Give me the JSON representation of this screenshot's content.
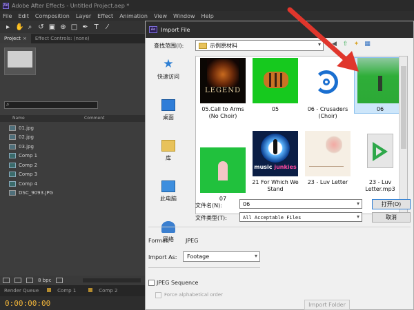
{
  "app": {
    "title": "Adobe After Effects - Untitled Project.aep *",
    "icon_name": "after-effects-icon"
  },
  "menu": [
    "File",
    "Edit",
    "Composition",
    "Layer",
    "Effect",
    "Animation",
    "View",
    "Window",
    "Help"
  ],
  "project_panel": {
    "tabs": [
      {
        "label": "Project",
        "close": "×"
      },
      {
        "label": "Effect Controls: (none)"
      }
    ],
    "columns": {
      "name": "Name",
      "comment": "Comment"
    },
    "items": [
      {
        "label": "01.jpg",
        "icon": "image-icon"
      },
      {
        "label": "02.jpg",
        "icon": "image-icon"
      },
      {
        "label": "03.jpg",
        "icon": "image-icon"
      },
      {
        "label": "Comp 1",
        "icon": "composition-icon"
      },
      {
        "label": "Comp 2",
        "icon": "composition-icon"
      },
      {
        "label": "Comp 3",
        "icon": "composition-icon"
      },
      {
        "label": "Comp 4",
        "icon": "composition-icon"
      },
      {
        "label": "DSC_9093.JPG",
        "icon": "image-icon"
      }
    ],
    "bpc": "8 bpc"
  },
  "bottom": {
    "tabs": [
      "Render Queue",
      "Comp 1",
      "Comp 2"
    ],
    "timecode": "0:00:00:00"
  },
  "import_dialog": {
    "title": "Import File",
    "look_in_label": "查找范围(I):",
    "look_in_value": "示例原材料",
    "places": [
      {
        "label": "快速访问",
        "icon": "quick-access-icon"
      },
      {
        "label": "桌面",
        "icon": "desktop-icon"
      },
      {
        "label": "库",
        "icon": "library-icon"
      },
      {
        "label": "此电脑",
        "icon": "this-pc-icon"
      },
      {
        "label": "网络",
        "icon": "network-icon"
      }
    ],
    "files": [
      {
        "label": "05.Call to Arms (No Choir)",
        "thumb": "legend"
      },
      {
        "label": "05",
        "thumb": "tiger"
      },
      {
        "label": "06 - Crusaders (Choir)",
        "thumb": "crusaders"
      },
      {
        "label": "06",
        "thumb": "green",
        "selected": true
      },
      {
        "label": "07",
        "thumb": "green-person"
      },
      {
        "label": "21 For Which We Stand",
        "thumb": "music-junkies"
      },
      {
        "label": "23 - Luv Letter",
        "thumb": "luv-letter"
      },
      {
        "label": "23 - Luv Letter.mp3",
        "thumb": "mp3"
      }
    ],
    "legend_text": "LEGEND",
    "music_brand_1": "music ",
    "music_brand_2": "junkies",
    "file_name_label": "文件名(N):",
    "file_name_value": "06",
    "file_type_label": "文件类型(T):",
    "file_type_value": "All Acceptable Files",
    "open_label": "打开(O)",
    "cancel_label": "取消",
    "format_label": "Format:",
    "format_value": "JPEG",
    "import_as_label": "Import As:",
    "import_as_value": "Footage",
    "jpeg_sequence_label": "JPEG Sequence",
    "force_alpha_label": "Force alphabetical order",
    "import_folder_label": "Import Folder"
  },
  "colors": {
    "accent": "#2f7ed3",
    "annotation": "#e0362c",
    "timecode": "#f0b43a"
  }
}
